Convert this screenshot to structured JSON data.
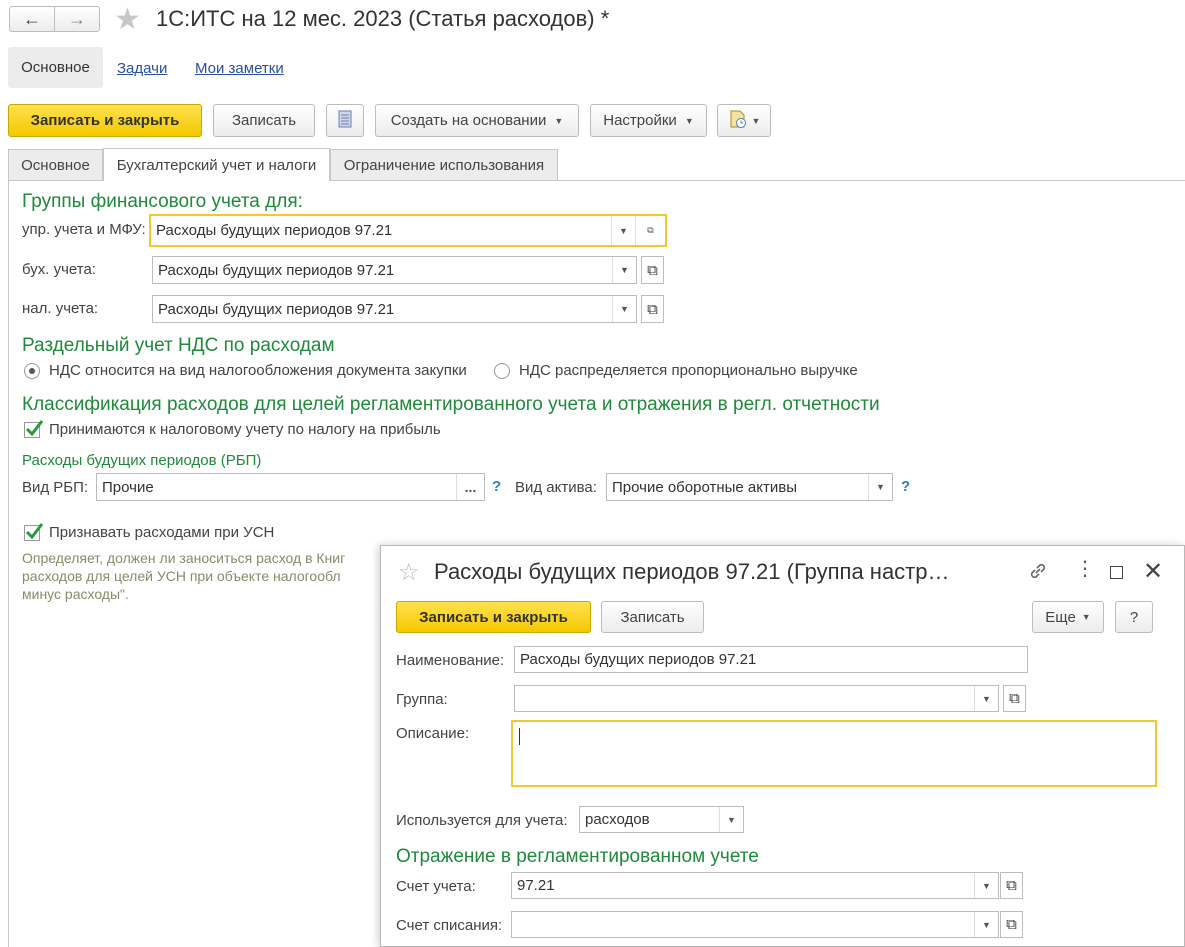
{
  "window": {
    "title": "1С:ИТС на 12 мес. 2023 (Статья расходов) *"
  },
  "nav": {
    "items": [
      "Основное",
      "Задачи",
      "Мои заметки"
    ]
  },
  "toolbar": {
    "save_close": "Записать и закрыть",
    "save": "Записать",
    "create_based": "Создать на основании",
    "settings": "Настройки"
  },
  "tabs": [
    "Основное",
    "Бухгалтерский учет и налоги",
    "Ограничение использования"
  ],
  "fin_groups": {
    "header": "Группы финансового учета для:",
    "rows": [
      {
        "label": "упр. учета и МФУ:",
        "value": "Расходы будущих периодов 97.21"
      },
      {
        "label": "бух. учета:",
        "value": "Расходы будущих периодов 97.21"
      },
      {
        "label": "нал. учета:",
        "value": "Расходы будущих периодов 97.21"
      }
    ]
  },
  "vat": {
    "header": "Раздельный учет НДС по расходам",
    "option1": "НДС относится на вид налогообложения документа закупки",
    "option2": "НДС распределяется пропорционально выручке",
    "selected": 1
  },
  "classification": {
    "header": "Классификация расходов для целей регламентированного учета и отражения в регл. отчетности",
    "profit_tax_checkbox": "Принимаются к налоговому учету по налогу на прибыль",
    "profit_tax_checked": true,
    "rbp_header": "Расходы будущих периодов (РБП)",
    "rbp_kind_label": "Вид РБП:",
    "rbp_kind_value": "Прочие",
    "asset_kind_label": "Вид актива:",
    "asset_kind_value": "Прочие оборотные активы",
    "help_mark": "?",
    "usn_checkbox": "Признавать расходами при УСН",
    "usn_checked": true,
    "usn_hint_line1": "Определяет, должен ли заноситься расход в Книг",
    "usn_hint_line2": "расходов для целей УСН при объекте налогообл",
    "usn_hint_line3": "минус расходы\"."
  },
  "dialog": {
    "title": "Расходы будущих периодов 97.21 (Группа настр…",
    "save_close": "Записать и закрыть",
    "save": "Записать",
    "more": "Еще",
    "help": "?",
    "name_label": "Наименование:",
    "name_value": "Расходы будущих периодов 97.21",
    "group_label": "Группа:",
    "group_value": "",
    "description_label": "Описание:",
    "description_value": "",
    "used_for_label": "Используется для учета:",
    "used_for_value": "расходов",
    "reg_header": "Отражение в регламентированном учете",
    "account_label": "Счет учета:",
    "account_value": "97.21",
    "writeoff_label": "Счет списания:",
    "writeoff_value": ""
  },
  "colors": {
    "accent_yellow": "#f4c800",
    "section_green": "#1f8a3b",
    "link_blue": "#2a4fa8"
  }
}
